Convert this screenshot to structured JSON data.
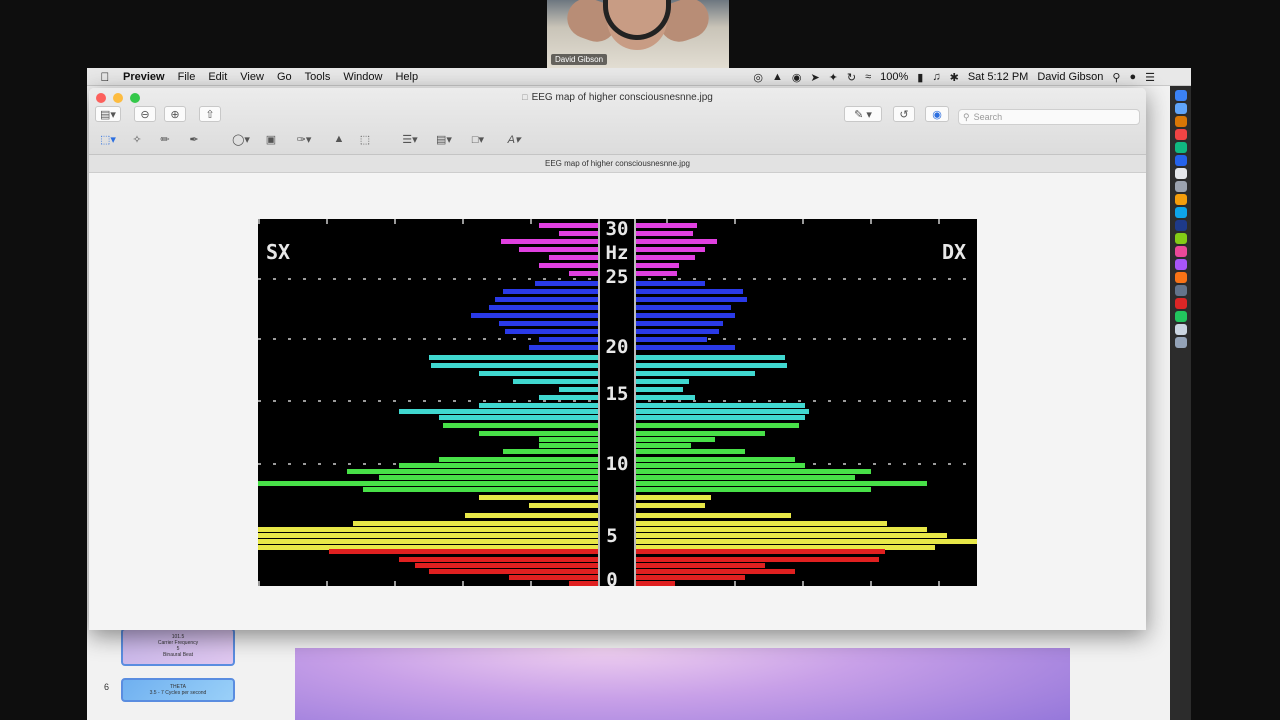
{
  "zoom": {
    "participant_name": "David Gibson"
  },
  "menubar": {
    "apple_icon": "apple-icon",
    "app_name": "Preview",
    "items": [
      "File",
      "Edit",
      "View",
      "Go",
      "Tools",
      "Window",
      "Help"
    ],
    "battery": "100%",
    "clock": "Sat 5:12 PM",
    "user": "David Gibson"
  },
  "window": {
    "title": "EEG map of higher consciousnesnne.jpg",
    "file_label": "EEG map of higher consciousnesnne.jpg",
    "search_placeholder": "Search"
  },
  "eeg_image": {
    "left_label": "SX",
    "right_label": "DX",
    "axis_labels": [
      "30",
      "Hz",
      "25",
      "20",
      "15",
      "10",
      "5",
      "0"
    ],
    "bands": [
      {
        "name": "beta-high",
        "color": "#e040e0"
      },
      {
        "name": "beta",
        "color": "#2a3ae8"
      },
      {
        "name": "alpha-high",
        "color": "#40d8d0"
      },
      {
        "name": "alpha",
        "color": "#48e048"
      },
      {
        "name": "theta",
        "color": "#e8e848"
      },
      {
        "name": "delta",
        "color": "#e02020"
      }
    ]
  },
  "keynote": {
    "thumb_5": [
      "101.5",
      "Carrier Frequency",
      "5",
      "Binaural Beat"
    ],
    "thumb_6_number": "6",
    "thumb_6": [
      "THETA",
      "3.5 - 7 Cycles per second"
    ]
  }
}
